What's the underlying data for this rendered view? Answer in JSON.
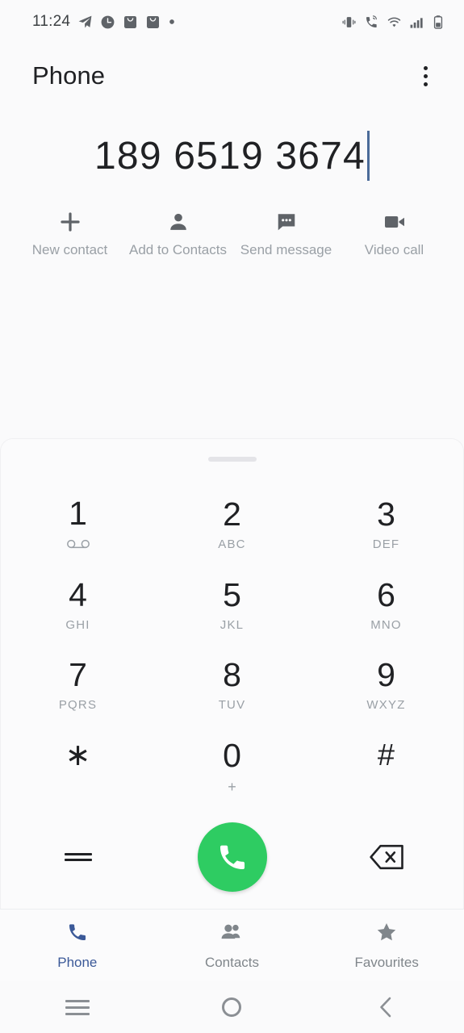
{
  "status_bar": {
    "time": "11:24",
    "left_icons": [
      "telegram-send-icon",
      "clock-icon",
      "mail-bag-icon",
      "mail-bag-icon",
      "dot-icon"
    ],
    "right_icons": [
      "vibrate-icon",
      "wifi-calling-icon",
      "wifi-icon",
      "signal-bars-icon",
      "battery-icon"
    ]
  },
  "app_bar": {
    "title": "Phone",
    "overflow_label": "More options"
  },
  "number_display": {
    "value": "189 6519 3674",
    "has_cursor": true
  },
  "actions": [
    {
      "label": "New contact",
      "icon": "plus-icon"
    },
    {
      "label": "Add to Contacts",
      "icon": "person-icon"
    },
    {
      "label": "Send message",
      "icon": "message-bubble-icon"
    },
    {
      "label": "Video call",
      "icon": "video-camera-icon"
    }
  ],
  "keypad": {
    "handle_label": "Drag handle",
    "keys": [
      {
        "digit": "1",
        "sub": "",
        "sub_icon": "voicemail-icon"
      },
      {
        "digit": "2",
        "sub": "ABC",
        "sub_icon": ""
      },
      {
        "digit": "3",
        "sub": "DEF",
        "sub_icon": ""
      },
      {
        "digit": "4",
        "sub": "GHI",
        "sub_icon": ""
      },
      {
        "digit": "5",
        "sub": "JKL",
        "sub_icon": ""
      },
      {
        "digit": "6",
        "sub": "MNO",
        "sub_icon": ""
      },
      {
        "digit": "7",
        "sub": "PQRS",
        "sub_icon": ""
      },
      {
        "digit": "8",
        "sub": "TUV",
        "sub_icon": ""
      },
      {
        "digit": "9",
        "sub": "WXYZ",
        "sub_icon": ""
      },
      {
        "digit": "∗",
        "sub": "",
        "sub_icon": ""
      },
      {
        "digit": "0",
        "sub": "+",
        "sub_icon": ""
      },
      {
        "digit": "#",
        "sub": "",
        "sub_icon": ""
      }
    ],
    "menu_key_icon": "hamburger-menu-icon",
    "call_button_icon": "phone-handset-icon",
    "backspace_icon": "backspace-icon",
    "call_button_color": "#2ecc62"
  },
  "tabs": [
    {
      "label": "Phone",
      "icon": "phone-handset-icon",
      "active": true
    },
    {
      "label": "Contacts",
      "icon": "people-icon",
      "active": false
    },
    {
      "label": "Favourites",
      "icon": "star-icon",
      "active": false
    }
  ],
  "system_nav": {
    "recents_icon": "recents-icon",
    "home_icon": "home-circle-icon",
    "back_icon": "back-chevron-icon"
  },
  "colors": {
    "accent_blue": "#3b5998",
    "call_green": "#2ecc62",
    "page_bg": "#fafafb",
    "sheet_bg": "#fbfbfc",
    "text_primary": "#202124",
    "text_muted": "#9aa0a6"
  }
}
